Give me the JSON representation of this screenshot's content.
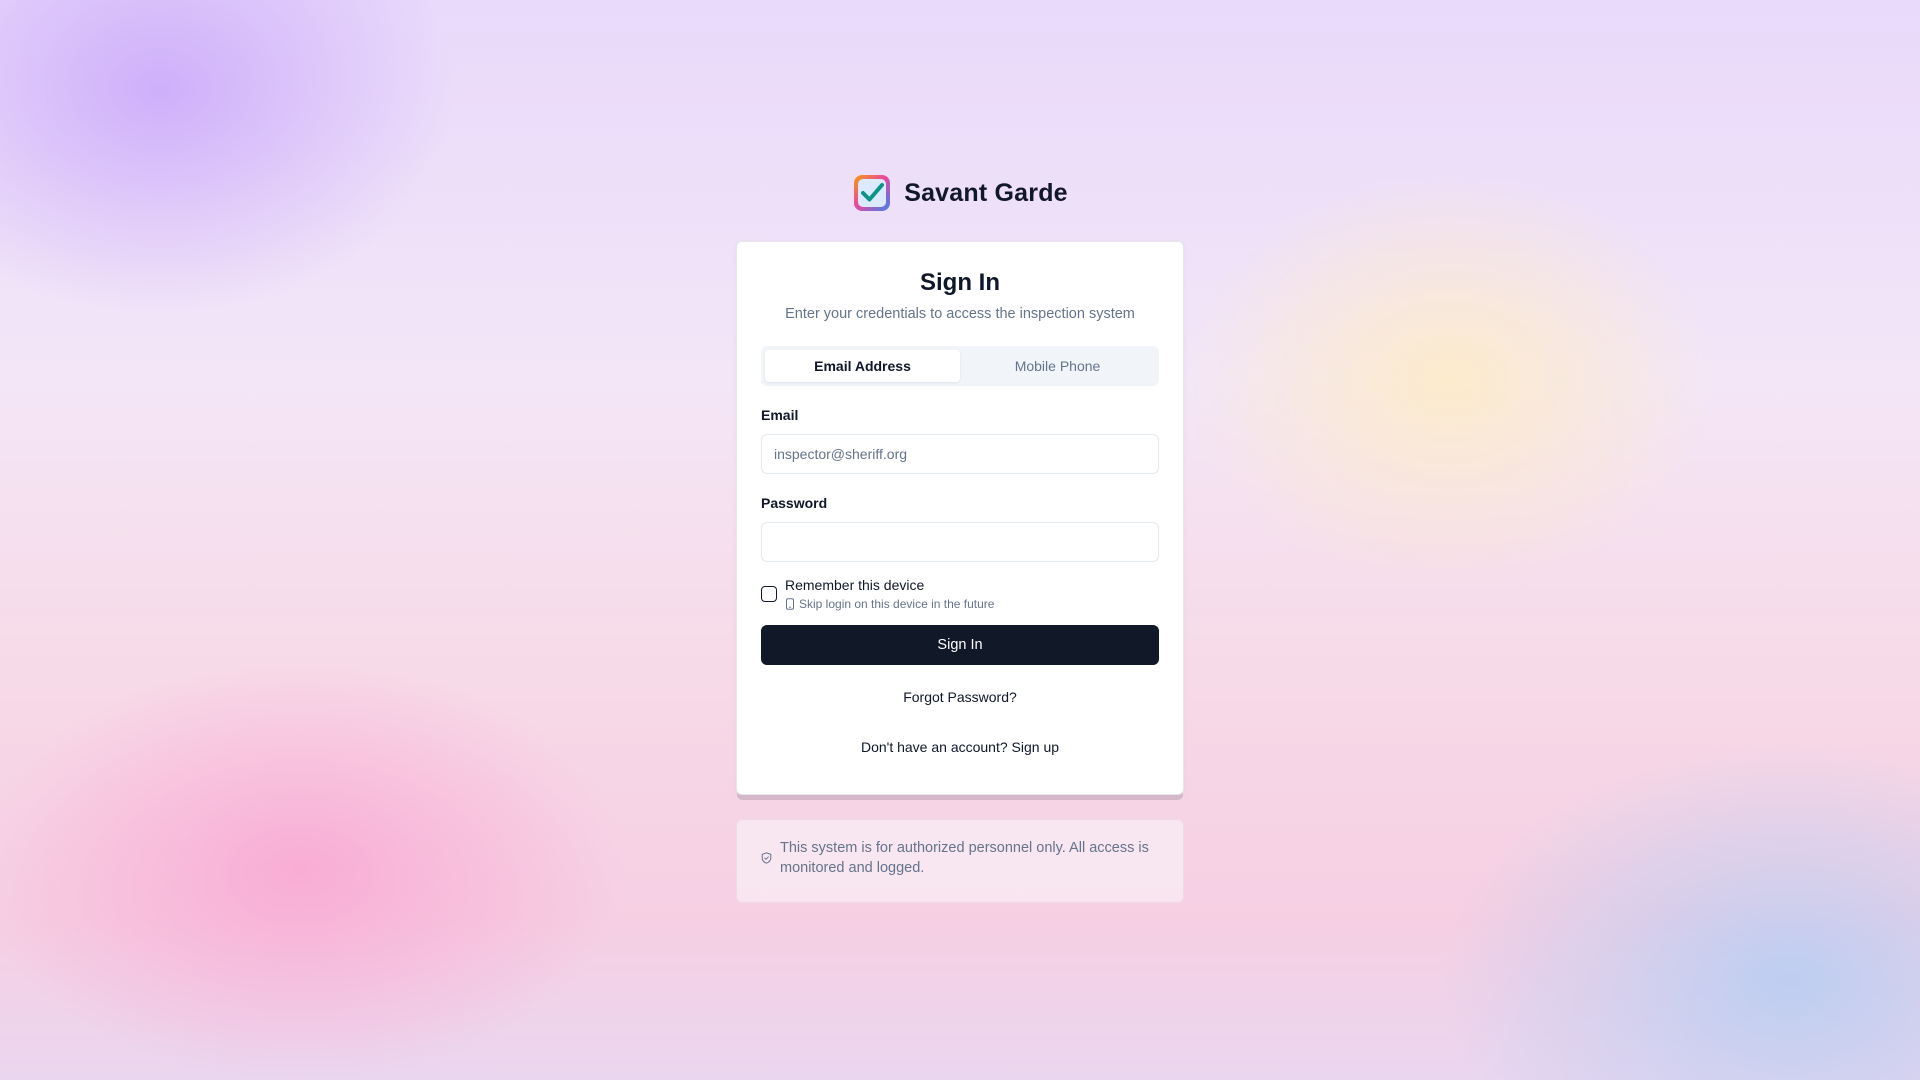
{
  "brand": {
    "name": "Savant Garde",
    "logo_icon": "checkbox-logo-icon"
  },
  "card": {
    "title": "Sign In",
    "subtitle": "Enter your credentials to access the inspection system",
    "tabs": [
      {
        "label": "Email Address",
        "active": true
      },
      {
        "label": "Mobile Phone",
        "active": false
      }
    ],
    "email": {
      "label": "Email",
      "value": "",
      "placeholder": "inspector@sheriff.org"
    },
    "password": {
      "label": "Password",
      "value": "",
      "placeholder": ""
    },
    "remember": {
      "label": "Remember this device",
      "hint": "Skip login on this device in the future",
      "checked": false,
      "hint_icon": "phone-icon"
    },
    "submit_label": "Sign In",
    "forgot_label": "Forgot Password?",
    "signup_prompt": "Don't have an account?",
    "signup_label": "Sign up"
  },
  "notice": {
    "icon": "shield-icon",
    "text": "This system is for authorized personnel only. All access is monitored and logged."
  },
  "colors": {
    "primary_button": "#111827",
    "muted_text": "#64748b"
  }
}
